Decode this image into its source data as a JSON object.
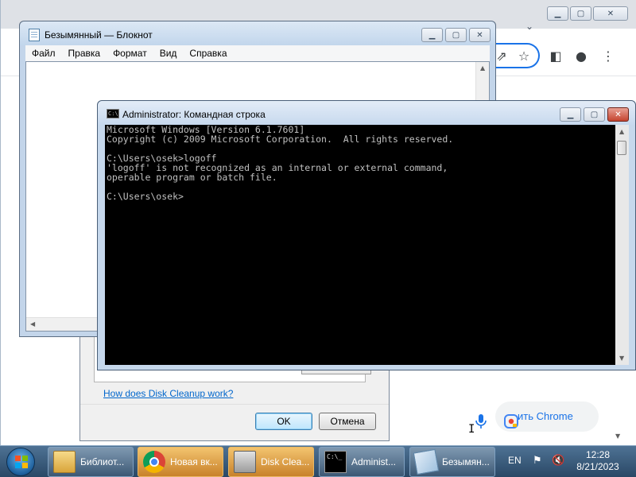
{
  "chrome": {
    "customize_label": "ить Chrome",
    "icons": [
      "share-icon",
      "star-icon",
      "sidepanel-icon",
      "profile-icon",
      "menu-icon",
      "mic-icon",
      "lens-icon"
    ]
  },
  "disk_cleanup": {
    "help_link": "How does Disk Cleanup work?",
    "ok_label": "OK",
    "cancel_label": "Отмена"
  },
  "notepad": {
    "title": "Безымянный — Блокнот",
    "menu": [
      "Файл",
      "Правка",
      "Формат",
      "Вид",
      "Справка"
    ],
    "content": ""
  },
  "cmd": {
    "title": "Administrator: Командная строка",
    "icon_text": "C:\\",
    "console_text": "Microsoft Windows [Version 6.1.7601]\nCopyright (c) 2009 Microsoft Corporation.  All rights reserved.\n\nC:\\Users\\osek>logoff\n'logoff' is not recognized as an internal or external command,\noperable program or batch file.\n\nC:\\Users\\osek>"
  },
  "taskbar": {
    "items": [
      {
        "label": "Библиот...",
        "icon": "library-icon",
        "active": false
      },
      {
        "label": "Новая вк...",
        "icon": "chrome-icon",
        "active": true
      },
      {
        "label": "Disk Clea...",
        "icon": "disk-cleanup-icon",
        "active": true
      },
      {
        "label": "Administ...",
        "icon": "cmd-icon",
        "active": false
      },
      {
        "label": "Безымян...",
        "icon": "notepad-icon",
        "active": false
      }
    ],
    "language": "EN",
    "time": "12:28",
    "date": "8/21/2023"
  },
  "colors": {
    "taskbar": "#2a4866",
    "console_bg": "#000000",
    "console_fg": "#c0c0c0",
    "link": "#0066cc",
    "chrome_accent": "#1a73e8"
  }
}
